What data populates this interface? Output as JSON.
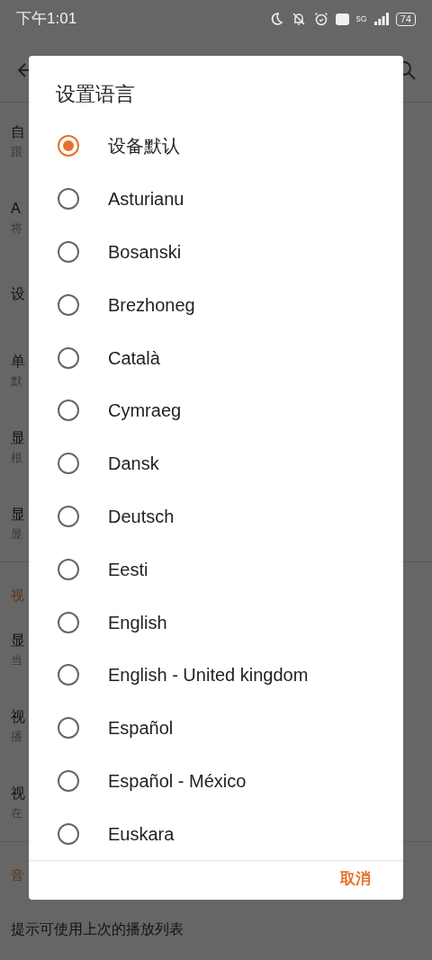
{
  "status_bar": {
    "time": "下午1:01",
    "battery": "74",
    "network": "5G"
  },
  "background": {
    "sections": [
      {
        "rows": [
          {
            "title": "自",
            "subtitle": "跟"
          },
          {
            "title": "A",
            "subtitle": "将"
          },
          {
            "title": "设"
          },
          {
            "title": "单",
            "subtitle": "默"
          },
          {
            "title": "显",
            "subtitle": "根"
          },
          {
            "title": "显",
            "subtitle": "显"
          }
        ]
      },
      {
        "header": "视",
        "rows": [
          {
            "title": "显",
            "subtitle": "当"
          },
          {
            "title": "视",
            "subtitle": "播"
          },
          {
            "title": "视",
            "subtitle": "在"
          }
        ]
      },
      {
        "header": "音",
        "rows": [
          {
            "title": "提示可使用上次的播放列表"
          }
        ]
      }
    ]
  },
  "dialog": {
    "title": "设置语言",
    "options": [
      {
        "label": "设备默认",
        "selected": true
      },
      {
        "label": "Asturianu",
        "selected": false
      },
      {
        "label": "Bosanski",
        "selected": false
      },
      {
        "label": "Brezhoneg",
        "selected": false
      },
      {
        "label": "Català",
        "selected": false
      },
      {
        "label": "Cymraeg",
        "selected": false
      },
      {
        "label": "Dansk",
        "selected": false
      },
      {
        "label": "Deutsch",
        "selected": false
      },
      {
        "label": "Eesti",
        "selected": false
      },
      {
        "label": "English",
        "selected": false
      },
      {
        "label": "English - United kingdom",
        "selected": false
      },
      {
        "label": "Español",
        "selected": false
      },
      {
        "label": "Español - México",
        "selected": false
      },
      {
        "label": "Euskara",
        "selected": false
      }
    ],
    "cancel": "取消"
  }
}
